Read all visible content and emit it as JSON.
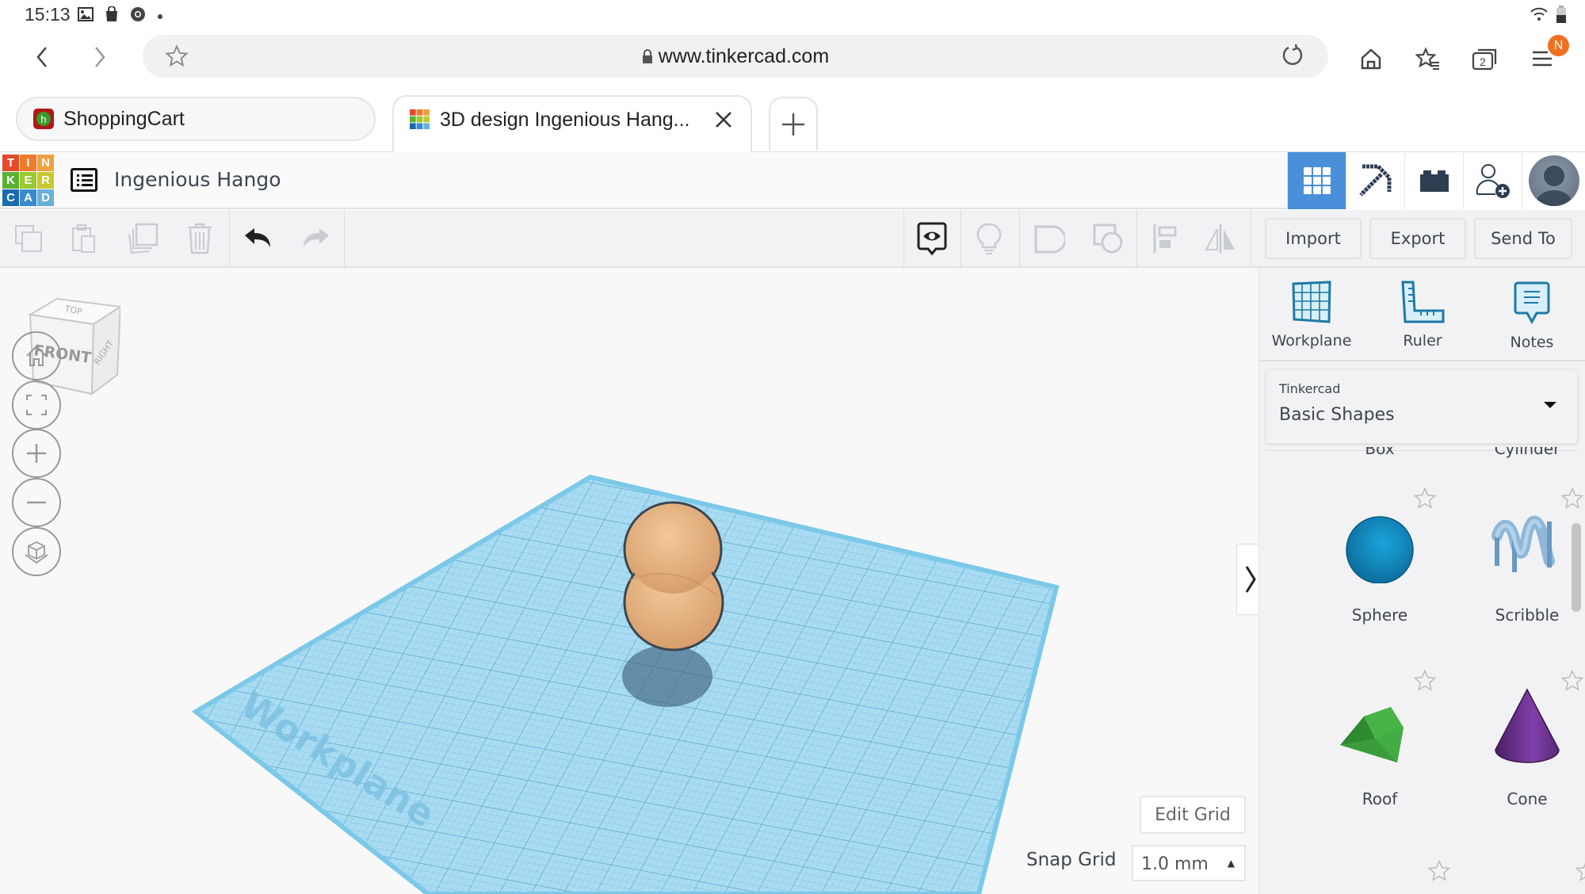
{
  "status_bar": {
    "time": "15:13",
    "left_icons": [
      "gallery-icon",
      "shopping-bag-icon",
      "chrome-icon",
      "dot-icon"
    ],
    "right_icons": [
      "wifi-icon",
      "battery-icon"
    ]
  },
  "browser": {
    "url": "www.tinkercad.com",
    "tabs": [
      {
        "label": "ShoppingCart",
        "active": false
      },
      {
        "label": "3D design Ingenious Hang...",
        "active": true
      }
    ],
    "tab_count": "2",
    "menu_badge": "N"
  },
  "app": {
    "logo_letters": [
      "T",
      "I",
      "N",
      "K",
      "E",
      "R",
      "C",
      "A",
      "D"
    ],
    "project_title": "Ingenious Hango",
    "header_buttons": [
      "3d-design-view",
      "codeblocks-view",
      "bricks-view",
      "invite-user",
      "profile"
    ]
  },
  "toolbar": {
    "import_label": "Import",
    "export_label": "Export",
    "sendto_label": "Send To"
  },
  "viewcube": {
    "top": "TOP",
    "front": "FRONT",
    "right": "RIGHT"
  },
  "workspace": {
    "workplane_label": "Workplane",
    "edit_grid_label": "Edit Grid",
    "snap_grid_label": "Snap Grid",
    "snap_grid_value": "1.0 mm",
    "object_color": "#e8b17e",
    "workplane_color": "#7cc8e8"
  },
  "panel": {
    "tools": [
      {
        "label": "Workplane"
      },
      {
        "label": "Ruler"
      },
      {
        "label": "Notes"
      }
    ],
    "library_source": "Tinkercad",
    "library_name": "Basic Shapes",
    "partial_shapes": [
      "Box",
      "Cylinder"
    ],
    "shapes": [
      {
        "label": "Sphere",
        "color": "#1a8fc8"
      },
      {
        "label": "Scribble",
        "color": "#8fb8d8"
      },
      {
        "label": "Roof",
        "color": "#3aa83a"
      },
      {
        "label": "Cone",
        "color": "#7a3a9a"
      }
    ]
  }
}
